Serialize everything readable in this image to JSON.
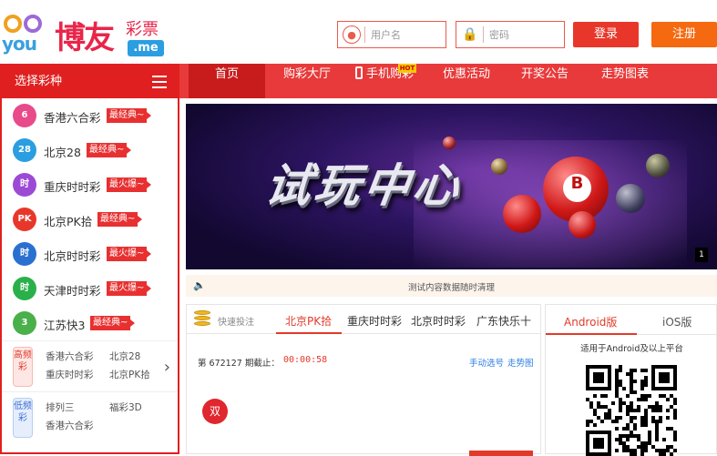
{
  "brand": {
    "logo_text": "博友",
    "logo_sub": "彩票",
    "logo_domain": ".me",
    "logo_you": "you"
  },
  "auth": {
    "username_placeholder": "用户名",
    "password_placeholder": "密码",
    "login_label": "登录",
    "register_label": "注册"
  },
  "sidebar": {
    "title": "选择彩种",
    "games": [
      {
        "name": "香港六合彩",
        "badge": "最经典~",
        "icon_text": "6",
        "color": "#e84a8a"
      },
      {
        "name": "北京28",
        "badge": "最经典~",
        "icon_text": "28",
        "color": "#2a9ee0"
      },
      {
        "name": "重庆时时彩",
        "badge": "最火爆~",
        "icon_text": "时",
        "color": "#9c4ad6"
      },
      {
        "name": "北京PK拾",
        "badge": "最经典~",
        "icon_text": "PK",
        "color": "#e8372a"
      },
      {
        "name": "北京时时彩",
        "badge": "最火爆~",
        "icon_text": "时",
        "color": "#2a70d0"
      },
      {
        "name": "天津时时彩",
        "badge": "最火爆~",
        "icon_text": "时",
        "color": "#2ab04a"
      },
      {
        "name": "江苏快3",
        "badge": "最经典~",
        "icon_text": "3",
        "color": "#4ab04a"
      }
    ],
    "high_freq": {
      "tag": "高频彩",
      "items": [
        "香港六合彩",
        "北京28",
        "重庆时时彩",
        "北京PK拾"
      ]
    },
    "low_freq": {
      "tag": "低频彩",
      "items": [
        "排列三",
        "福彩3D",
        "香港六合彩"
      ]
    }
  },
  "nav": {
    "items": [
      "首页",
      "购彩大厅",
      "手机购彩",
      "优惠活动",
      "开奖公告",
      "走势图表"
    ],
    "hot_label": "HOT"
  },
  "banner": {
    "title": "试玩中心",
    "slide_index": "1"
  },
  "notice": {
    "text": "测试内容数据随时清理"
  },
  "quick_bet": {
    "label": "快速投注",
    "tabs": [
      "北京PK拾",
      "重庆时时彩",
      "北京时时彩",
      "广东快乐十"
    ],
    "issue_prefix": "第",
    "issue_no": "672127",
    "issue_suffix": "期截止：",
    "countdown": "00:00:58",
    "links": [
      "手动选号",
      "走势图"
    ],
    "ball": "双"
  },
  "download": {
    "tabs": [
      "Android版",
      "iOS版"
    ],
    "hint": "适用于Android及以上平台"
  },
  "colors": {
    "primary": "#e83a3a",
    "accent_orange": "#f56a10",
    "link": "#2a7de1"
  }
}
